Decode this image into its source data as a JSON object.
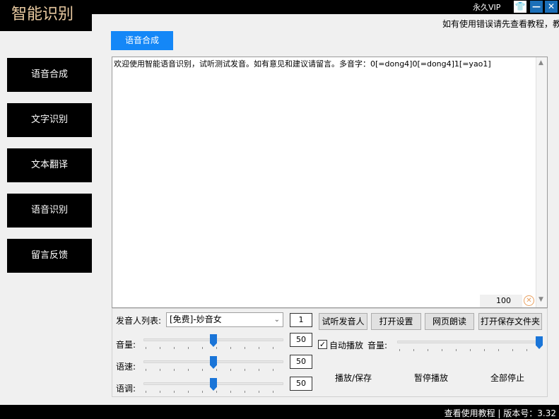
{
  "app": {
    "title": "智能识别",
    "vip_label": "永久VIP"
  },
  "window_buttons": {
    "skin": "👕",
    "minimize": "—",
    "close": "✕"
  },
  "notice": "如有使用错误请先查看教程，教",
  "active_tab": "语音合成",
  "sidebar": {
    "items": [
      {
        "label": "语音合成"
      },
      {
        "label": "文字识别"
      },
      {
        "label": "文本翻译"
      },
      {
        "label": "语音识别"
      },
      {
        "label": "留言反馈"
      }
    ]
  },
  "editor": {
    "text": "欢迎使用智能语音识别，试听测试发音。如有意见和建议请留言。多音字：0[=dong4]0[=dong4]1[=yao1]",
    "char_count": "100"
  },
  "voice": {
    "list_label": "发音人列表:",
    "selected": "[免费]-妙音女",
    "count": "1"
  },
  "buttons": {
    "preview_voice": "试听发音人",
    "open_settings": "打开设置",
    "web_read": "网页朗读",
    "open_save_folder": "打开保存文件夹"
  },
  "sliders": {
    "volume": {
      "label": "音量:",
      "value": "50",
      "level": 0.5
    },
    "speed": {
      "label": "语速:",
      "value": "50",
      "level": 0.5
    },
    "pitch": {
      "label": "语调:",
      "value": "50",
      "level": 0.5
    }
  },
  "playback": {
    "autoplay_label": "自动播放",
    "autoplay_checked": true,
    "volume_label": "音量:",
    "volume_level": 1.0,
    "play_save": "播放/保存",
    "pause": "暂停播放",
    "stop_all": "全部停止"
  },
  "footer": "查看使用教程 | 版本号：3.32"
}
